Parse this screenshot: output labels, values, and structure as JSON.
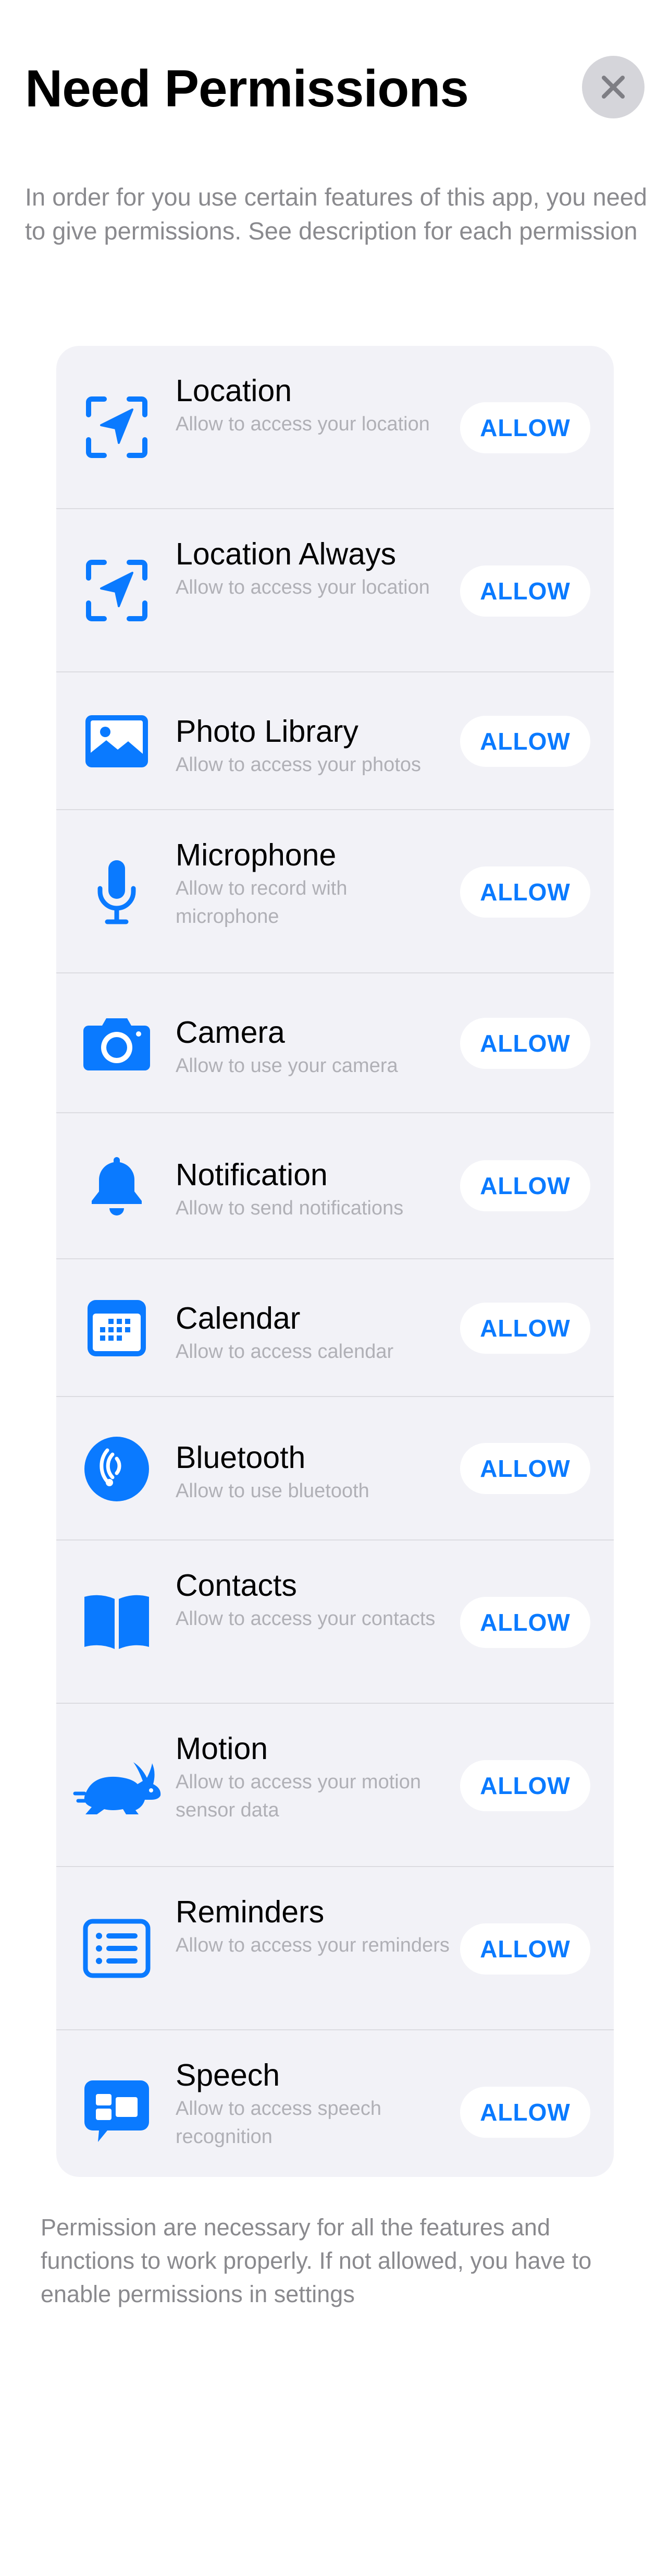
{
  "header": {
    "title": "Need Permissions",
    "intro": "In order for you use certain features of this app, you need to give permissions. See description for each permission"
  },
  "accent_color": "#0a7aff",
  "permissions": [
    {
      "title": "Location",
      "description": "Allow to access your location",
      "button": "ALLOW",
      "icon": "location-icon"
    },
    {
      "title": "Location Always",
      "description": "Allow to access your location",
      "button": "ALLOW",
      "icon": "location-always-icon"
    },
    {
      "title": "Photo Library",
      "description": "Allow to access your photos",
      "button": "ALLOW",
      "icon": "photo-library-icon"
    },
    {
      "title": "Microphone",
      "description": "Allow to record with microphone",
      "button": "ALLOW",
      "icon": "microphone-icon"
    },
    {
      "title": "Camera",
      "description": "Allow to use your camera",
      "button": "ALLOW",
      "icon": "camera-icon"
    },
    {
      "title": "Notification",
      "description": "Allow to send notifications",
      "button": "ALLOW",
      "icon": "bell-icon"
    },
    {
      "title": "Calendar",
      "description": "Allow to access calendar",
      "button": "ALLOW",
      "icon": "calendar-icon"
    },
    {
      "title": "Bluetooth",
      "description": "Allow to use bluetooth",
      "button": "ALLOW",
      "icon": "bluetooth-icon"
    },
    {
      "title": "Contacts",
      "description": "Allow to access your contacts",
      "button": "ALLOW",
      "icon": "book-icon"
    },
    {
      "title": "Motion",
      "description": "Allow to access your motion sensor data",
      "button": "ALLOW",
      "icon": "rabbit-icon"
    },
    {
      "title": "Reminders",
      "description": "Allow to access your reminders",
      "button": "ALLOW",
      "icon": "list-icon"
    },
    {
      "title": "Speech",
      "description": "Allow to access speech recognition",
      "button": "ALLOW",
      "icon": "speech-bubble-icon"
    }
  ],
  "footer": {
    "note": "Permission are necessary for all the features and functions to work properly. If not allowed, you have to enable permissions in settings"
  }
}
